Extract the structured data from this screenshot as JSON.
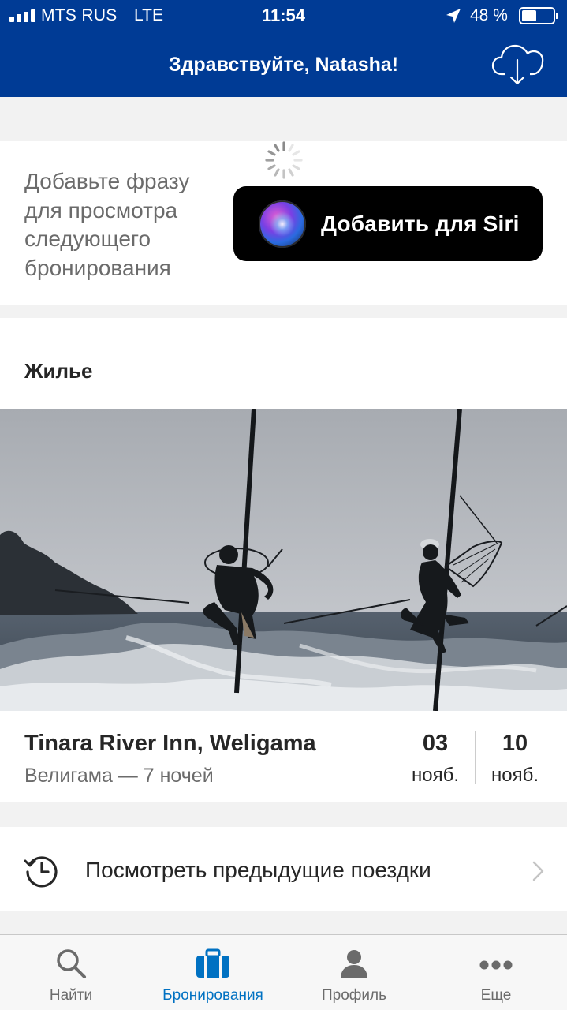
{
  "status_bar": {
    "carrier": "MTS RUS",
    "network": "LTE",
    "time": "11:54",
    "battery": "48 %",
    "battery_level": 0.48
  },
  "header": {
    "greeting": "Здравствуйте, Natasha!",
    "action_icon": "cloud-download-icon"
  },
  "siri": {
    "prompt": "Добавьте фразу для просмотра следующего бронирования",
    "button_label": "Добавить для Siri"
  },
  "stays": {
    "section_title": "Жилье",
    "booking": {
      "hotel": "Tinara River Inn, Weligama",
      "location_nights": "Велигама — 7 ночей",
      "checkin_day": "03",
      "checkin_month": "нояб.",
      "checkout_day": "10",
      "checkout_month": "нояб."
    }
  },
  "past_trips": {
    "label": "Посмотреть предыдущие поездки"
  },
  "tabbar": {
    "tabs": [
      {
        "label": "Найти",
        "icon": "search-icon"
      },
      {
        "label": "Бронирования",
        "icon": "briefcase-icon",
        "active": true
      },
      {
        "label": "Профиль",
        "icon": "profile-icon"
      },
      {
        "label": "Еще",
        "icon": "more-icon"
      }
    ]
  },
  "colors": {
    "brand_blue": "#003b95",
    "accent_blue": "#0071c2",
    "text": "#262626",
    "muted": "#6b6b6b"
  }
}
